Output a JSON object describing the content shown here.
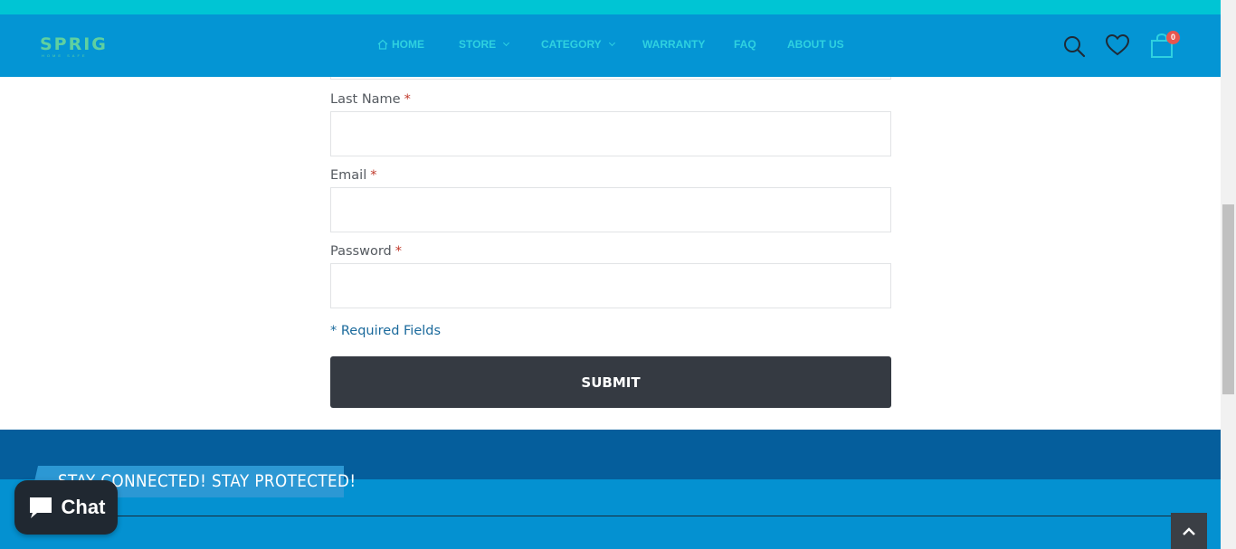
{
  "header": {
    "logo_text": "SPRIG",
    "logo_subtext": "HOME SAFE",
    "nav": {
      "home": "HOME",
      "store": "STORE",
      "category": "CATEGORY",
      "warranty": "WARRANTY",
      "faq": "FAQ",
      "about": "ABOUT US"
    },
    "cart_count": "0"
  },
  "form": {
    "last_name_label": "Last Name",
    "email_label": "Email",
    "password_label": "Password",
    "required_marker": "*",
    "required_note": "* Required Fields",
    "submit_label": "SUBMIT"
  },
  "footer": {
    "banner_text": "STAY CONNECTED! STAY PROTECTED!"
  },
  "chat": {
    "label": "Chat"
  },
  "colors": {
    "top_strip": "#00c5d4",
    "header": "#0495d4",
    "nav_text": "#2fd1e0",
    "submit": "#353a42",
    "footer_dark": "#055e9c",
    "footer_light": "#0491d1",
    "badge": "#e8554e"
  },
  "icons": [
    "home-icon",
    "chevron-down-icon",
    "search-icon",
    "heart-icon",
    "cart-icon",
    "chat-bubble-icon",
    "arrow-up-icon"
  ]
}
